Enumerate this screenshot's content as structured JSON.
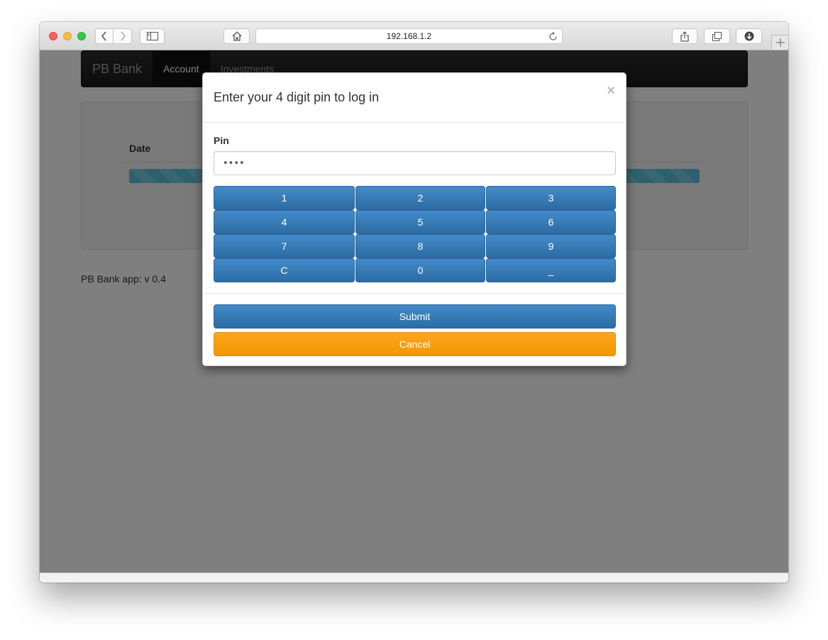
{
  "browser": {
    "address": "192.168.1.2",
    "icons": {
      "back": "chevron-left-icon",
      "forward": "chevron-right-icon",
      "sidebar": "sidebar-icon",
      "home": "home-icon",
      "reload": "reload-icon",
      "share": "share-icon",
      "tabs": "tabs-icon",
      "download": "download-icon",
      "new_tab": "plus-icon"
    }
  },
  "page": {
    "brand": "PB Bank",
    "nav": [
      "Account",
      "Investments"
    ],
    "active_nav": "Account",
    "table_header": "Date",
    "footer": "PB Bank app: v 0.4"
  },
  "modal": {
    "title": "Enter your 4 digit pin to log in",
    "close": "×",
    "pin_label": "Pin",
    "pin_value": "••••",
    "keypad": [
      "1",
      "2",
      "3",
      "4",
      "5",
      "6",
      "7",
      "8",
      "9",
      "C",
      "0",
      "_"
    ],
    "submit": "Submit",
    "cancel": "Cancel"
  },
  "colors": {
    "primary": "#337ab7",
    "warning": "#f59b0a",
    "progress": "#5bc0de",
    "navbar": "#222222"
  }
}
